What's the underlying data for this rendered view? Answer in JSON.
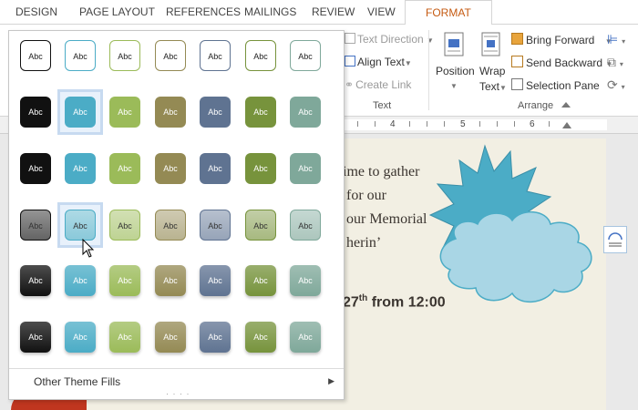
{
  "tabs": [
    "DESIGN",
    "PAGE LAYOUT",
    "REFERENCES",
    "MAILINGS",
    "REVIEW",
    "VIEW",
    "FORMAT"
  ],
  "ribbon": {
    "text_direction": "Text Direction",
    "align_text": "Align Text",
    "create_link": "Create Link",
    "group_text": "Text",
    "position": "Position",
    "wrap_text_1": "Wrap",
    "wrap_text_2": "Text",
    "bring_forward": "Bring Forward",
    "send_backward": "Send Backward",
    "selection_pane": "Selection Pane",
    "group_arrange": "Arrange"
  },
  "ruler": [
    "4",
    "5",
    "6"
  ],
  "document": {
    "line1": "ime to gather",
    "line2": "for our",
    "line3": "our Memorial",
    "line4": "herin’",
    "date_num": "27",
    "date_sup": "th",
    "date_rest": " from 12:00"
  },
  "gallery": {
    "label": "Abc",
    "other_fills": "Other Theme Fills",
    "colors": [
      "#111111",
      "#4bacc6",
      "#9bbb59",
      "#948a54",
      "#5f7391",
      "#77933c",
      "#7fa89a"
    ],
    "styles": [
      "outline",
      "solid",
      "solid",
      "light",
      "gradient",
      "gradient"
    ],
    "selected": [
      [
        1,
        1
      ],
      [
        3,
        1
      ]
    ]
  }
}
